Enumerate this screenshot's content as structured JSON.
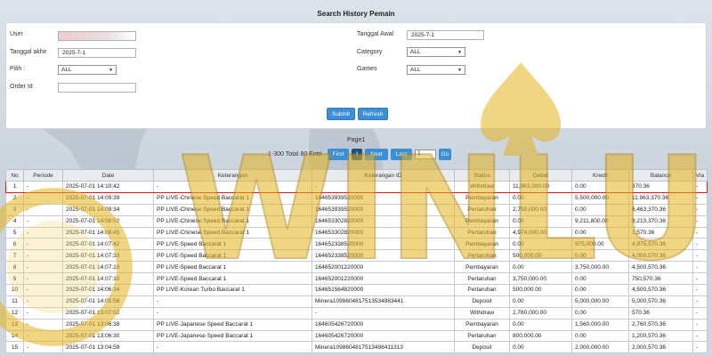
{
  "header": {
    "title": "Search History Pemain"
  },
  "form": {
    "user_label": "User",
    "user_value": "",
    "tanggal_akhir_label": "Tanggal akhir",
    "tanggal_akhir_value": "2025-7-1",
    "pilih_label": "Pilih :",
    "pilih_value": "ALL",
    "order_id_label": "Order Id",
    "order_id_value": "",
    "tanggal_awal_label": "Tanggal Awal",
    "tanggal_awal_value": "2025-7-1",
    "category_label": "Category",
    "category_value": "ALL",
    "games_label": "Games",
    "games_value": "ALL",
    "submit_label": "Submit",
    "refresh_label": "Refresh"
  },
  "pager": {
    "page_label": "Page1",
    "summary": "1-300 Total 80 Entri",
    "first": "First",
    "current": "1",
    "next": "Next",
    "last": "Last",
    "input_value": "1",
    "go": "Go"
  },
  "table": {
    "headers": [
      "No",
      "Periode",
      "Date",
      "Keterangan",
      "Keterangan ID",
      "Status",
      "Debet",
      "Kredit",
      "Balance",
      "Via"
    ],
    "rows": [
      {
        "no": "1",
        "periode": "-",
        "date": "2025-07-01 14:10:42",
        "ket": "-",
        "ket_id": "-",
        "status": "Withdraw",
        "debet": "11,963,000.00",
        "kredit": "0.00",
        "balance": "370.36",
        "via": "-"
      },
      {
        "no": "2",
        "periode": "-",
        "date": "2025-07-01 14:09:39",
        "ket": "PP LIVE-Chinese Speed Baccarat 1",
        "ket_id": "164653939520000",
        "status": "Pembayaran",
        "debet": "0.00",
        "kredit": "5,500,000.00",
        "balance": "11,963,370.36",
        "via": "-"
      },
      {
        "no": "3",
        "periode": "-",
        "date": "2025-07-01 14:09:34",
        "ket": "PP LIVE-Chinese Speed Baccarat 1",
        "ket_id": "164653939520000",
        "status": "Pertaruhan",
        "debet": "2,750,000.00",
        "kredit": "0.00",
        "balance": "6,463,370.36",
        "via": "-"
      },
      {
        "no": "4",
        "periode": "-",
        "date": "2025-07-01 14:08:52",
        "ket": "PP LIVE-Chinese Speed Baccarat 1",
        "ket_id": "164653302820000",
        "status": "Pembayaran",
        "debet": "0.00",
        "kredit": "9,211,800.00",
        "balance": "9,213,370.36",
        "via": "-"
      },
      {
        "no": "5",
        "periode": "-",
        "date": "2025-07-01 14:08:45",
        "ket": "PP LIVE-Chinese Speed Baccarat 1",
        "ket_id": "164653302820000",
        "status": "Pertaruhan",
        "debet": "4,974,000.00",
        "kredit": "0.00",
        "balance": "1,570.36",
        "via": "-"
      },
      {
        "no": "6",
        "periode": "-",
        "date": "2025-07-01 14:07:42",
        "ket": "PP LIVE-Speed Baccarat 1",
        "ket_id": "164652338520000",
        "status": "Pembayaran",
        "debet": "0.00",
        "kredit": "975,000.00",
        "balance": "4,975,570.36",
        "via": "-"
      },
      {
        "no": "7",
        "periode": "-",
        "date": "2025-07-01 14:07:33",
        "ket": "PP LIVE-Speed Baccarat 1",
        "ket_id": "164652338520000",
        "status": "Pertaruhan",
        "debet": "500,000.00",
        "kredit": "0.00",
        "balance": "4,000,570.36",
        "via": "-"
      },
      {
        "no": "8",
        "periode": "-",
        "date": "2025-07-01 14:07:16",
        "ket": "PP LIVE-Speed Baccarat 1",
        "ket_id": "164652001220000",
        "status": "Pembayaran",
        "debet": "0.00",
        "kredit": "3,750,000.00",
        "balance": "4,500,570.36",
        "via": "-"
      },
      {
        "no": "9",
        "periode": "-",
        "date": "2025-07-01 14:07:10",
        "ket": "PP LIVE-Speed Baccarat 1",
        "ket_id": "164652001220000",
        "status": "Pertaruhan",
        "debet": "3,750,000.00",
        "kredit": "0.00",
        "balance": "750,570.36",
        "via": "-"
      },
      {
        "no": "10",
        "periode": "-",
        "date": "2025-07-01 14:06:34",
        "ket": "PP LIVE-Korean Turbo Baccarat 1",
        "ket_id": "164651564820000",
        "status": "Pertaruhan",
        "debet": "500,000.00",
        "kredit": "0.00",
        "balance": "4,500,570.36",
        "via": "-"
      },
      {
        "no": "11",
        "periode": "-",
        "date": "2025-07-01 14:05:58",
        "ket": "-",
        "ket_id": "Minera1098604817513534983441",
        "status": "Deposit",
        "debet": "0.00",
        "kredit": "5,000,000.00",
        "balance": "5,000,570.36",
        "via": "-"
      },
      {
        "no": "12",
        "periode": "-",
        "date": "2025-07-01 13:07:02",
        "ket": "-",
        "ket_id": "-",
        "status": "Withdraw",
        "debet": "2,760,000.00",
        "kredit": "0.00",
        "balance": "570.36",
        "via": "-"
      },
      {
        "no": "13",
        "periode": "-",
        "date": "2025-07-01 13:06:38",
        "ket": "PP LIVE-Japanese Speed Baccarat 1",
        "ket_id": "164605426720000",
        "status": "Pembayaran",
        "debet": "0.00",
        "kredit": "1,560,000.00",
        "balance": "2,760,570.36",
        "via": "-"
      },
      {
        "no": "14",
        "periode": "-",
        "date": "2025-07-01 13:06:30",
        "ket": "PP LIVE-Japanese Speed Baccarat 1",
        "ket_id": "164605426720000",
        "status": "Pertaruhan",
        "debet": "800,000.00",
        "kredit": "0.00",
        "balance": "1,200,570.36",
        "via": "-"
      },
      {
        "no": "15",
        "periode": "-",
        "date": "2025-07-01 13:04:59",
        "ket": "-",
        "ket_id": "Minera1098604817513498411313",
        "status": "Deposit",
        "debet": "0.00",
        "kredit": "2,000,000.00",
        "balance": "2,000,570.36",
        "via": "-"
      }
    ]
  },
  "colors": {
    "accent": "#3a8fd6",
    "highlight": "#d81a1a",
    "link": "#2a6ed8",
    "debit_red": "#d60000",
    "credit_green": "#1e9c2b",
    "watermark_gold": "#e3b21d"
  },
  "watermark": {
    "text": "WINLUK"
  }
}
